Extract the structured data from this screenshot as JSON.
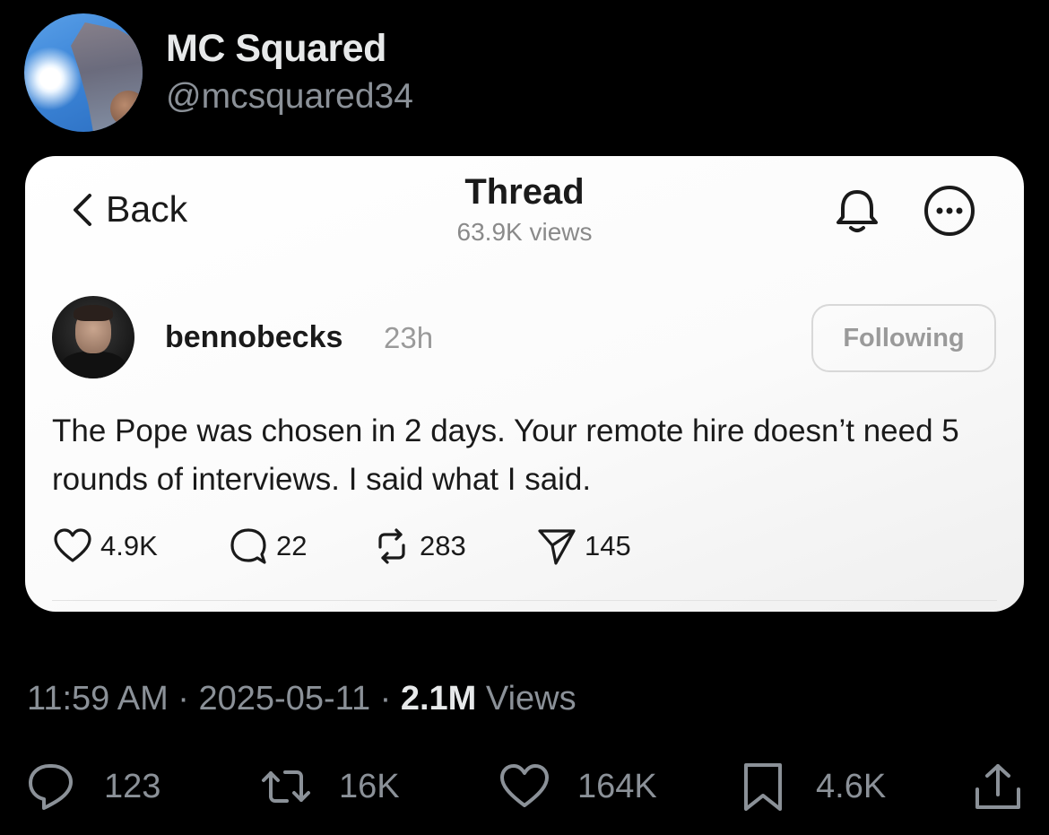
{
  "outer_post": {
    "display_name": "MC Squared",
    "handle": "@mcsquared34",
    "time": "11:59 AM",
    "separator": "·",
    "date": "2025-05-11",
    "views_count": "2.1M",
    "views_label": "Views",
    "actions": {
      "replies": "123",
      "reposts": "16K",
      "likes": "164K",
      "bookmarks": "4.6K"
    }
  },
  "thread_card": {
    "back_label": "Back",
    "title": "Thread",
    "views": "63.9K views",
    "author": {
      "username": "bennobecks",
      "time": "23h",
      "follow_label": "Following"
    },
    "post_text": "The Pope was chosen in 2 days. Your remote hire doesn’t need 5 rounds of interviews. I said what I said.",
    "actions": {
      "likes": "4.9K",
      "replies": "22",
      "reposts": "283",
      "shares": "145"
    }
  },
  "colors": {
    "background": "#000000",
    "card": "#ffffff",
    "muted_text": "#8b9198",
    "primary_text": "#e7e9ea"
  }
}
